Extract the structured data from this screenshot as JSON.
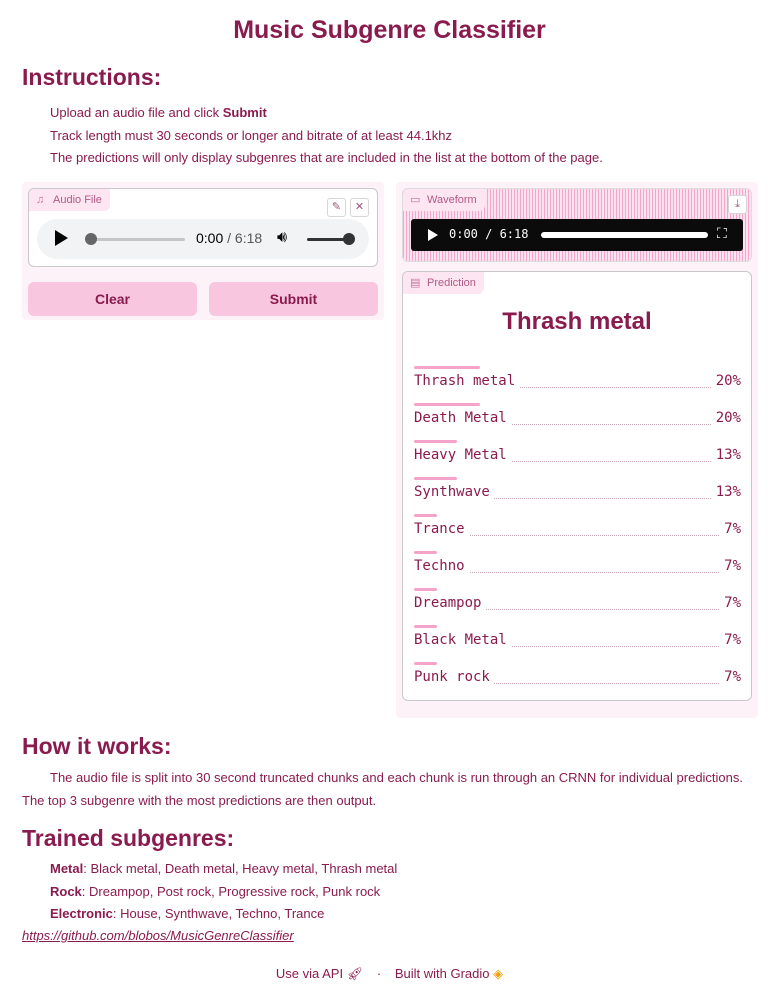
{
  "app": {
    "title": "Music Subgenre Classifier"
  },
  "instructions": {
    "heading": "Instructions:",
    "line1_prefix": "Upload an audio file and click ",
    "line1_bold": "Submit",
    "line2": "Track length must 30 seconds or longer and bitrate of at least 44.1khz",
    "line3": "The predictions will only display subgenres that are included in the list at the bottom of the page."
  },
  "audio_input": {
    "label": "Audio File",
    "current_time": "0:00",
    "separator": "/",
    "duration": "6:18",
    "progress": 0
  },
  "buttons": {
    "clear": "Clear",
    "submit": "Submit"
  },
  "waveform": {
    "label": "Waveform",
    "time_display": "0:00 / 6:18"
  },
  "prediction": {
    "label": "Prediction",
    "top_label": "Thrash metal",
    "items": [
      {
        "label": "Thrash metal",
        "percent": "20%",
        "fraction": 0.2
      },
      {
        "label": "Death Metal",
        "percent": "20%",
        "fraction": 0.2
      },
      {
        "label": "Heavy Metal",
        "percent": "13%",
        "fraction": 0.13
      },
      {
        "label": "Synthwave",
        "percent": "13%",
        "fraction": 0.13
      },
      {
        "label": "Trance",
        "percent": "7%",
        "fraction": 0.07
      },
      {
        "label": "Techno",
        "percent": "7%",
        "fraction": 0.07
      },
      {
        "label": "Dreampop",
        "percent": "7%",
        "fraction": 0.07
      },
      {
        "label": "Black Metal",
        "percent": "7%",
        "fraction": 0.07
      },
      {
        "label": "Punk rock",
        "percent": "7%",
        "fraction": 0.07
      }
    ]
  },
  "how_it_works": {
    "heading": "How it works:",
    "text": "The audio file is split into 30 second truncated chunks and each chunk is run through an CRNN for individual predictions. The top 3 subgenre with the most predictions are then output."
  },
  "trained": {
    "heading": "Trained subgenres:",
    "metal_name": "Metal",
    "metal_list": ": Black metal, Death metal, Heavy metal, Thrash metal",
    "rock_name": "Rock",
    "rock_list": ": Dreampop, Post rock, Progressive rock, Punk rock",
    "electronic_name": "Electronic",
    "electronic_list": ": House, Synthwave, Techno, Trance",
    "link": "https://github.com/blobos/MusicGenreClassifier"
  },
  "footer": {
    "api": "Use via API",
    "separator": "·",
    "built": "Built with Gradio"
  },
  "colors": {
    "accent": "#8a1b4e",
    "button": "#f9c6e0",
    "panel": "#fdf2f7",
    "bar": "#f5a3c9"
  }
}
